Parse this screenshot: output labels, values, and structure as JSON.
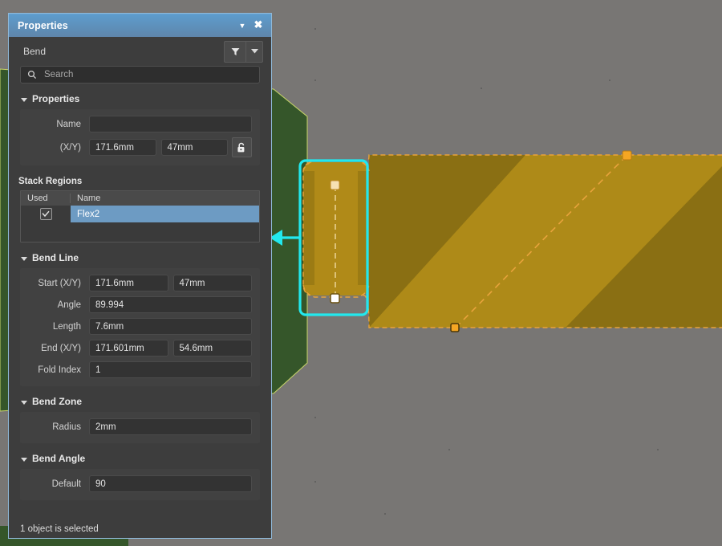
{
  "window": {
    "title": "Properties",
    "collapse_icon": "chevron-down-icon",
    "close_icon": "close-icon"
  },
  "toolbar": {
    "object_type": "Bend",
    "filter_icon": "funnel-icon",
    "filter_dropdown_icon": "chevron-down-icon"
  },
  "search": {
    "icon": "search-icon",
    "value": "",
    "placeholder": "Search"
  },
  "sections": {
    "properties": {
      "title": "Properties",
      "name_label": "Name",
      "name_value": "",
      "xy_label": "(X/Y)",
      "x_value": "171.6mm",
      "y_value": "47mm",
      "lock_icon": "unlocked-padlock-icon"
    },
    "stack_regions": {
      "title": "Stack Regions",
      "columns": [
        "Used",
        "Name"
      ],
      "rows": [
        {
          "used": true,
          "name": "Flex2",
          "checkbox_icon": "check-icon",
          "selected": true
        }
      ]
    },
    "bend_line": {
      "title": "Bend Line",
      "start_label": "Start (X/Y)",
      "start_x": "171.6mm",
      "start_y": "47mm",
      "angle_label": "Angle",
      "angle_value": "89.994",
      "length_label": "Length",
      "length_value": "7.6mm",
      "end_label": "End (X/Y)",
      "end_x": "171.601mm",
      "end_y": "54.6mm",
      "fold_index_label": "Fold Index",
      "fold_index_value": "1"
    },
    "bend_zone": {
      "title": "Bend Zone",
      "radius_label": "Radius",
      "radius_value": "2mm"
    },
    "bend_angle": {
      "title": "Bend Angle",
      "default_label": "Default",
      "default_value": "90"
    }
  },
  "status": {
    "text": "1 object is selected"
  },
  "viewport": {
    "background_color": "#787674",
    "board_color": "#8a6f13",
    "board_highlight_color": "#b08a18",
    "green_region_color": "#35562a",
    "outline_color": "#e8a33d",
    "selection_color": "#22e8ee",
    "vertex_color": "#f2c27a",
    "annotation": "bend-region-callout-arrow"
  }
}
